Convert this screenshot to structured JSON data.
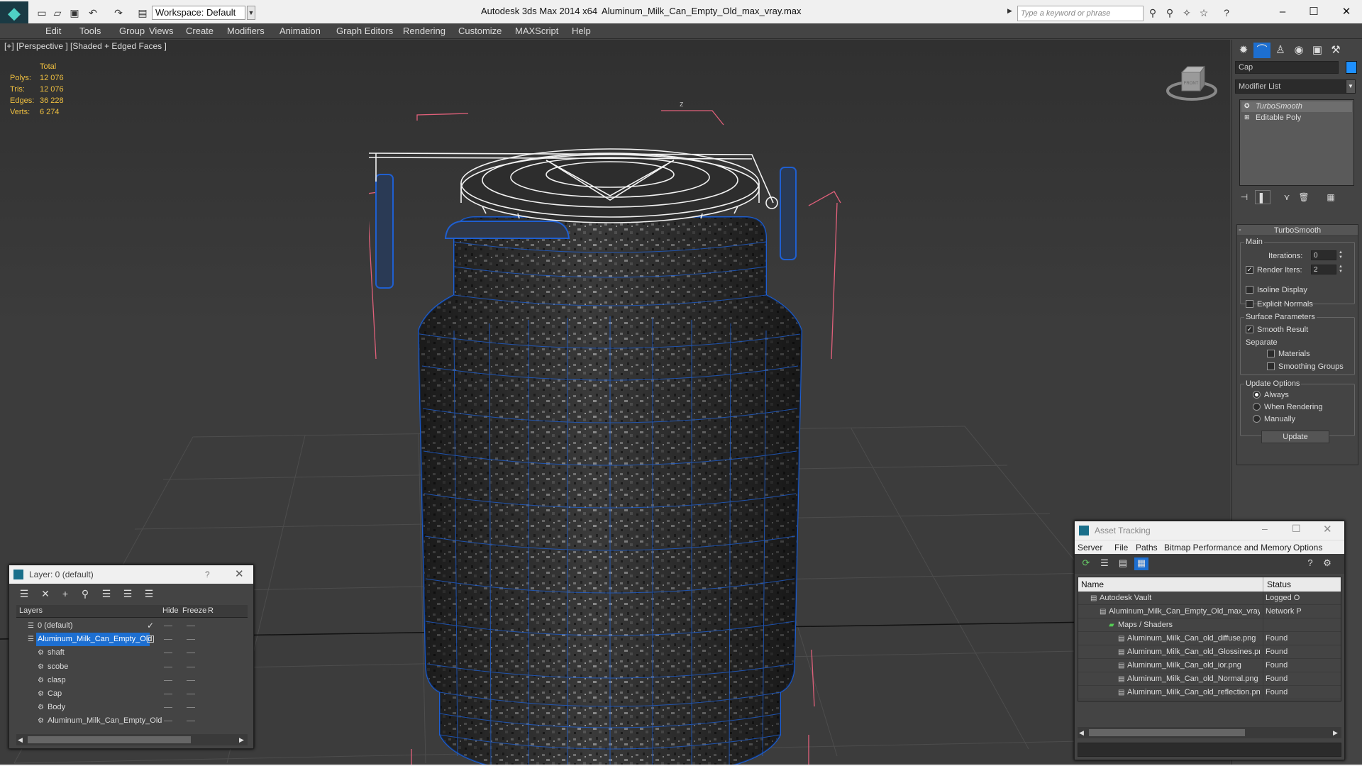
{
  "titlebar": {
    "app_title": "Autodesk 3ds Max  2014 x64",
    "file_title": "Aluminum_Milk_Can_Empty_Old_max_vray.max",
    "workspace": "Workspace: Default",
    "search_placeholder": "Type a keyword or phrase"
  },
  "menus": [
    "Edit",
    "Tools",
    "Group",
    "Views",
    "Create",
    "Modifiers",
    "Animation",
    "Graph Editors",
    "Rendering",
    "Customize",
    "MAXScript",
    "Help"
  ],
  "viewport": {
    "label": "[+] [Perspective ] [Shaded + Edged Faces ]",
    "stats_header": "Total",
    "stats": [
      {
        "label": "Polys:",
        "value": "12 076"
      },
      {
        "label": "Tris:",
        "value": "12 076"
      },
      {
        "label": "Edges:",
        "value": "36 228"
      },
      {
        "label": "Verts:",
        "value": "6 274"
      }
    ],
    "viewcube_label": "FRONT",
    "axis_label": "z"
  },
  "command_panel": {
    "object_name": "Cap",
    "modifier_list": "Modifier List",
    "stack": [
      {
        "label": "TurboSmooth",
        "italic": true
      },
      {
        "label": "Editable Poly",
        "italic": false
      }
    ],
    "rollout_title": "TurboSmooth",
    "main_group": "Main",
    "iterations_label": "Iterations:",
    "iterations_value": "0",
    "render_iters_label": "Render Iters:",
    "render_iters_value": "2",
    "isoline_label": "Isoline Display",
    "explicit_normals_label": "Explicit Normals",
    "surface_group": "Surface Parameters",
    "smooth_result_label": "Smooth Result",
    "separate_label": "Separate",
    "materials_label": "Materials",
    "smoothing_groups_label": "Smoothing Groups",
    "update_group": "Update Options",
    "always_label": "Always",
    "when_rendering_label": "When Rendering",
    "manually_label": "Manually",
    "update_button": "Update"
  },
  "layer_window": {
    "title": "Layer: 0 (default)",
    "help": "?",
    "columns": [
      "Layers",
      "Hide",
      "Freeze",
      "R"
    ],
    "rows": [
      {
        "name": "0 (default)",
        "indent": 0,
        "selected": false,
        "check": true
      },
      {
        "name": "Aluminum_Milk_Can_Empty_Old",
        "indent": 0,
        "selected": true,
        "check": false
      },
      {
        "name": "shaft",
        "indent": 1,
        "selected": false,
        "check": false
      },
      {
        "name": "scobe",
        "indent": 1,
        "selected": false,
        "check": false
      },
      {
        "name": "clasp",
        "indent": 1,
        "selected": false,
        "check": false
      },
      {
        "name": "Cap",
        "indent": 1,
        "selected": false,
        "check": false
      },
      {
        "name": "Body",
        "indent": 1,
        "selected": false,
        "check": false
      },
      {
        "name": "Aluminum_Milk_Can_Empty_Old",
        "indent": 1,
        "selected": false,
        "check": false
      }
    ]
  },
  "asset_window": {
    "title": "Asset Tracking",
    "menus": [
      "Server",
      "File",
      "Paths",
      "Bitmap Performance and Memory",
      "Options"
    ],
    "columns": [
      "Name",
      "Status"
    ],
    "rows": [
      {
        "name": "Autodesk Vault",
        "status": "Logged O",
        "indent": 1
      },
      {
        "name": "Aluminum_Milk_Can_Empty_Old_max_vray.max",
        "status": "Network P",
        "indent": 2
      },
      {
        "name": "Maps / Shaders",
        "status": "",
        "indent": 3
      },
      {
        "name": "Aluminum_Milk_Can_old_diffuse.png",
        "status": "Found",
        "indent": 4
      },
      {
        "name": "Aluminum_Milk_Can_old_Glossines.png",
        "status": "Found",
        "indent": 4
      },
      {
        "name": "Aluminum_Milk_Can_old_ior.png",
        "status": "Found",
        "indent": 4
      },
      {
        "name": "Aluminum_Milk_Can_old_Normal.png",
        "status": "Found",
        "indent": 4
      },
      {
        "name": "Aluminum_Milk_Can_old_reflection.png",
        "status": "Found",
        "indent": 4
      }
    ]
  },
  "colors": {
    "selection": "#1d6fd1",
    "stats": "#f0c040",
    "wire_blue": "#1f5fd0",
    "bbox_pink": "#e0607a",
    "object_color": "#1e90ff"
  }
}
